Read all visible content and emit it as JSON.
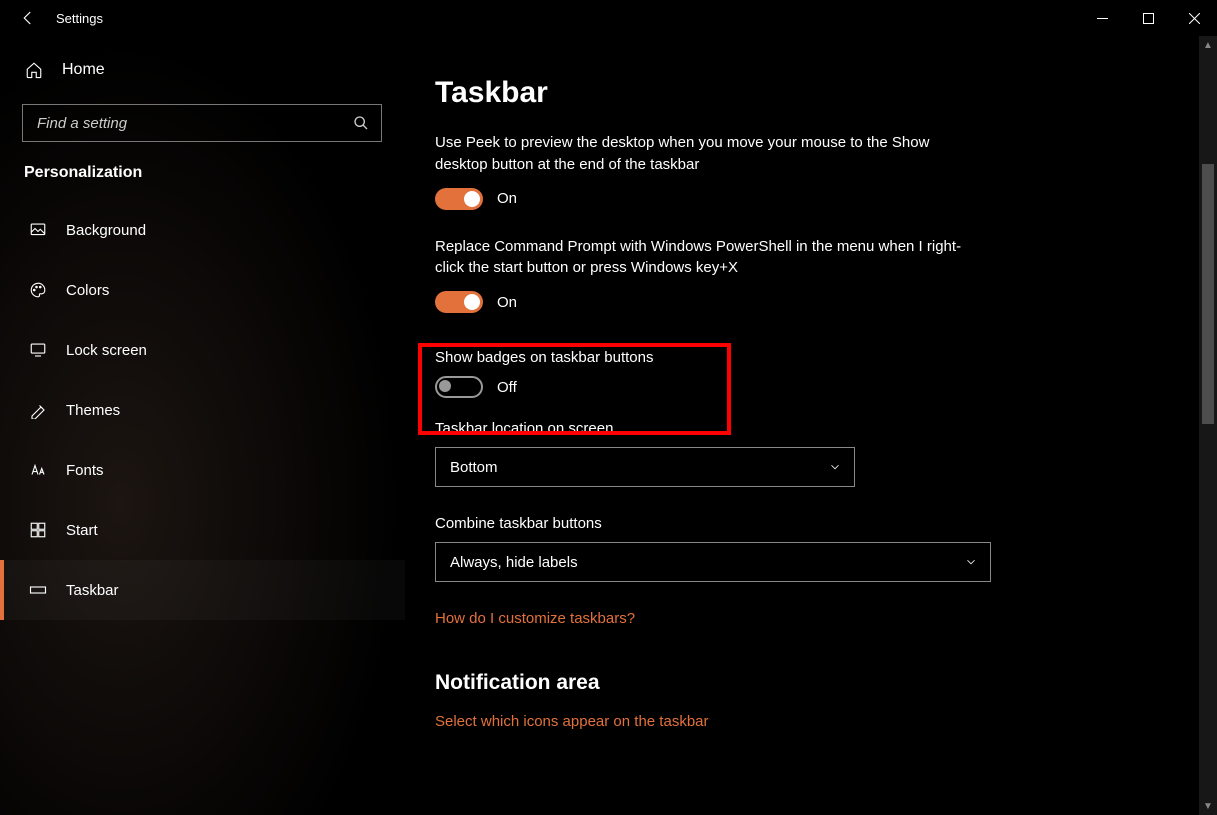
{
  "titlebar": {
    "title": "Settings"
  },
  "sidebar": {
    "home": "Home",
    "search_placeholder": "Find a setting",
    "section": "Personalization",
    "items": [
      {
        "label": "Background"
      },
      {
        "label": "Colors"
      },
      {
        "label": "Lock screen"
      },
      {
        "label": "Themes"
      },
      {
        "label": "Fonts"
      },
      {
        "label": "Start"
      },
      {
        "label": "Taskbar"
      }
    ]
  },
  "content": {
    "title": "Taskbar",
    "peek_desc": "Use Peek to preview the desktop when you move your mouse to the Show desktop button at the end of the taskbar",
    "peek_state": "On",
    "powershell_desc": "Replace Command Prompt with Windows PowerShell in the menu when I right-click the start button or press Windows key+X",
    "powershell_state": "On",
    "badges_label": "Show badges on taskbar buttons",
    "badges_state": "Off",
    "location_label": "Taskbar location on screen",
    "location_value": "Bottom",
    "combine_label": "Combine taskbar buttons",
    "combine_value": "Always, hide labels",
    "customize_link": "How do I customize taskbars?",
    "notification_heading": "Notification area",
    "icons_link": "Select which icons appear on the taskbar"
  }
}
